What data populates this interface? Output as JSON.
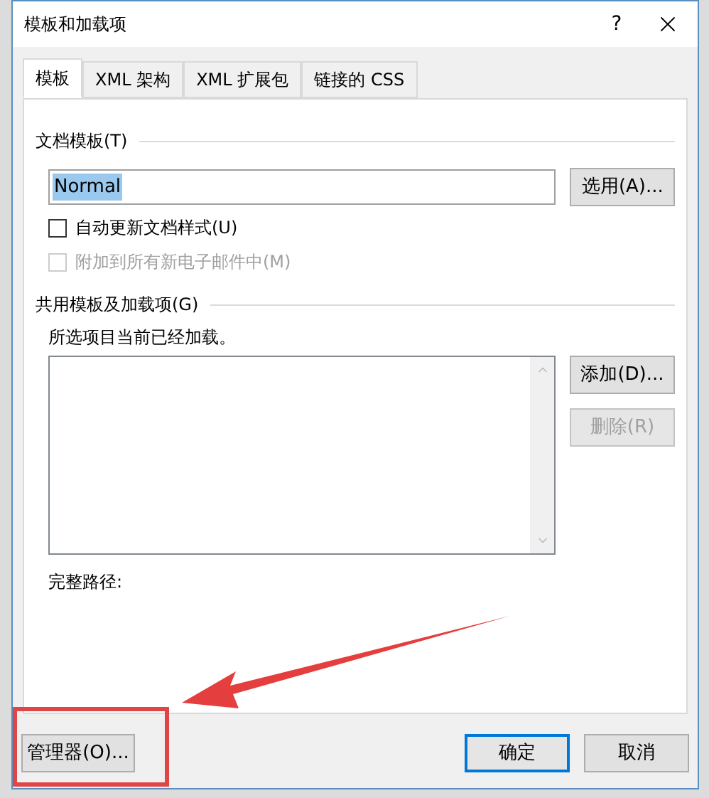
{
  "window": {
    "title": "模板和加载项",
    "help": "?"
  },
  "tabs": [
    {
      "label": "模板",
      "selected": true
    },
    {
      "label": "XML 架构",
      "selected": false
    },
    {
      "label": "XML 扩展包",
      "selected": false
    },
    {
      "label": "链接的 CSS",
      "selected": false
    }
  ],
  "document_template": {
    "heading": "文档模板(T)",
    "value": "Normal",
    "attach_button": {
      "label": "选用(A)...",
      "disabled": false
    },
    "options": [
      {
        "label": "自动更新文档样式(U)",
        "checked": false,
        "disabled": false
      },
      {
        "label": "附加到所有新电子邮件中(M)",
        "checked": false,
        "disabled": true
      }
    ]
  },
  "global_templates": {
    "heading": "共用模板及加载项(G)",
    "note": "所选项目当前已经加载。",
    "buttons": [
      {
        "label": "添加(D)...",
        "disabled": false
      },
      {
        "label": "删除(R)",
        "disabled": true
      }
    ],
    "full_path_label": "完整路径:"
  },
  "footer": {
    "organizer_button": {
      "label": "管理器(O)...",
      "default": false
    },
    "buttons": [
      {
        "label": "确定",
        "default": true
      },
      {
        "label": "取消",
        "default": false
      }
    ]
  }
}
